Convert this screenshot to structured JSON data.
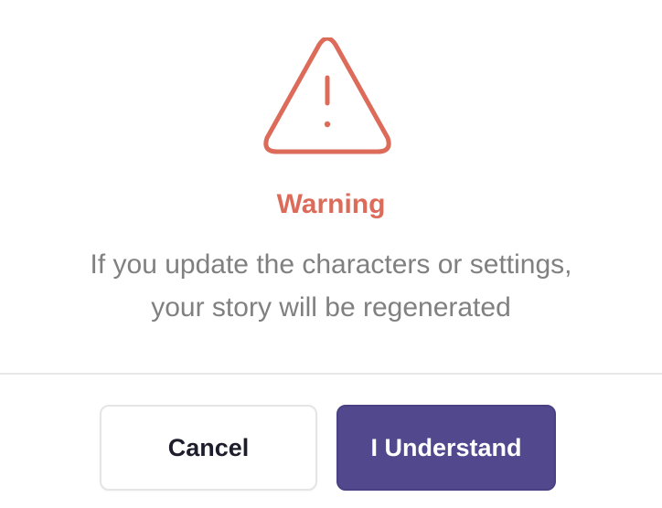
{
  "dialog": {
    "icon": "warning-triangle-icon",
    "title": "Warning",
    "message_lines": [
      "If you update the characters or settings,",
      "your story will be regenerated"
    ],
    "cancel_label": "Cancel",
    "confirm_label": "I Understand"
  },
  "colors": {
    "warning": "#dd6b5a",
    "message_text": "#808080",
    "primary_button": "#51488e",
    "primary_button_text": "#ffffff",
    "secondary_button_text": "#1d1d2b",
    "divider": "#e8e8e8"
  }
}
